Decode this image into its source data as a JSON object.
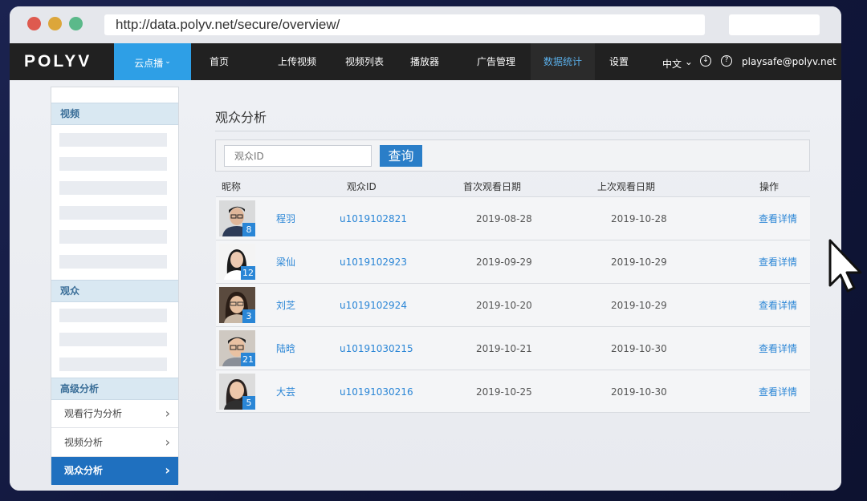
{
  "browser": {
    "url": "http://data.polyv.net/secure/overview/"
  },
  "navbar": {
    "logo": "POLYV",
    "cloud_label": "云点播",
    "items": [
      "首页",
      "上传视频",
      "视频列表",
      "播放器",
      "广告管理",
      "数据统计",
      "设置"
    ],
    "active_item": "数据统计",
    "language": "中文",
    "language_chevron": "⌄",
    "download_glyph": "↓",
    "help_glyph": "?",
    "email": "playsafe@polyv.net"
  },
  "sidebar": {
    "section_video": "视频",
    "section_audience": "观众",
    "section_advanced": "高级分析",
    "items": [
      {
        "label": "观看行为分析",
        "active": false
      },
      {
        "label": "视频分析",
        "active": false
      },
      {
        "label": "观众分析",
        "active": true
      }
    ],
    "arrow": "›"
  },
  "main": {
    "title": "观众分析",
    "search": {
      "placeholder": "观众ID",
      "button": "查询"
    },
    "table": {
      "headers": {
        "nickname": "昵称",
        "viewer_id": "观众ID",
        "first_date": "首次观看日期",
        "last_date": "上次观看日期",
        "action": "操作"
      },
      "rows": [
        {
          "count": "8",
          "name": "程羽",
          "id": "u1019102821",
          "first": "2019-08-28",
          "last": "2019-10-28",
          "action": "查看详情"
        },
        {
          "count": "12",
          "name": "梁仙",
          "id": "u1019102923",
          "first": "2019-09-29",
          "last": "2019-10-29",
          "action": "查看详情"
        },
        {
          "count": "3",
          "name": "刘芝",
          "id": "u1019102924",
          "first": "2019-10-20",
          "last": "2019-10-29",
          "action": "查看详情"
        },
        {
          "count": "21",
          "name": "陆晗",
          "id": "u10191030215",
          "first": "2019-10-21",
          "last": "2019-10-30",
          "action": "查看详情"
        },
        {
          "count": "5",
          "name": "大芸",
          "id": "u10191030216",
          "first": "2019-10-25",
          "last": "2019-10-30",
          "action": "查看详情"
        }
      ]
    }
  },
  "colors": {
    "accent": "#2e9fe6",
    "nav_bg": "#212121",
    "link": "#2b86d6",
    "active_sidebar": "#1f70bf"
  }
}
